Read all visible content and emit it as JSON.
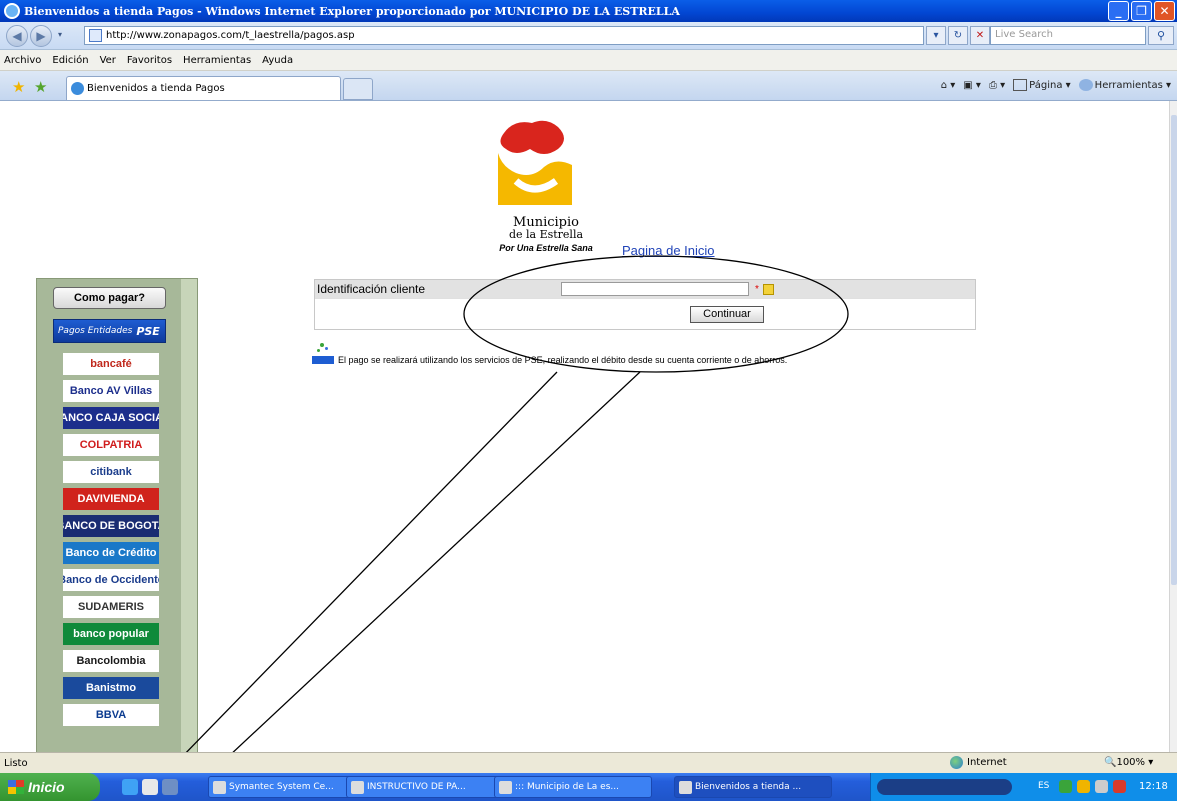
{
  "window": {
    "title": "Bienvenidos a tienda Pagos - Windows Internet Explorer proporcionado por MUNICIPIO DE LA ESTRELLA"
  },
  "address_bar": {
    "url": "http://www.zonapagos.com/t_laestrella/pagos.asp",
    "search_placeholder": "Live Search"
  },
  "menu": [
    "Archivo",
    "Edición",
    "Ver",
    "Favoritos",
    "Herramientas",
    "Ayuda"
  ],
  "tab": {
    "label": "Bienvenidos a tienda Pagos"
  },
  "command_bar": {
    "page": "Página",
    "tools": "Herramientas"
  },
  "page": {
    "logo": {
      "name_line1": "Municipio",
      "name_line2": "de la Estrella",
      "tagline": "Por Una Estrella Sana"
    },
    "home_link": "Pagina de Inicio",
    "sidebar": {
      "como_pagar": "Como pagar?",
      "pse_label": "Pagos Entidades",
      "pse_logo": "PSE",
      "banks": [
        {
          "name": "bancafé",
          "bg": "#ffffff",
          "color": "#c0281c"
        },
        {
          "name": "Banco AV Villas",
          "bg": "#ffffff",
          "color": "#1c2e8c"
        },
        {
          "name": "BANCO CAJA SOCIAL",
          "bg": "#1c2e8c",
          "color": "#ffffff"
        },
        {
          "name": "COLPATRIA",
          "bg": "#ffffff",
          "color": "#d01c1c"
        },
        {
          "name": "citibank",
          "bg": "#ffffff",
          "color": "#1c3e8c"
        },
        {
          "name": "DAVIVIENDA",
          "bg": "#d0231c",
          "color": "#ffffff"
        },
        {
          "name": "BANCO DE BOGOTA",
          "bg": "#1a2c72",
          "color": "#ffffff"
        },
        {
          "name": "Banco de Crédito",
          "bg": "#1a78c8",
          "color": "#ffffff"
        },
        {
          "name": "Banco de Occidente",
          "bg": "#ffffff",
          "color": "#1a3c8c"
        },
        {
          "name": "SUDAMERIS",
          "bg": "#ffffff",
          "color": "#333333"
        },
        {
          "name": "banco popular",
          "bg": "#0f8a3a",
          "color": "#ffffff"
        },
        {
          "name": "Bancolombia",
          "bg": "#ffffff",
          "color": "#1a1a1a"
        },
        {
          "name": "Banistmo",
          "bg": "#1a4a9c",
          "color": "#ffffff"
        },
        {
          "name": "BBVA",
          "bg": "#ffffff",
          "color": "#0b3b8f"
        }
      ]
    },
    "form": {
      "label": "Identificación cliente",
      "value": "",
      "required_mark": "*",
      "submit": "Continuar"
    },
    "note": "El pago se realizará utilizando los servicios de PSE, realizando el débito desde su cuenta corriente o de ahorros."
  },
  "status_bar": {
    "status": "Listo",
    "zone": "Internet",
    "zoom": "100%"
  },
  "taskbar": {
    "start": "Inicio",
    "tasks": [
      {
        "label": "Symantec System Ce...",
        "active": false
      },
      {
        "label": "INSTRUCTIVO DE PA...",
        "active": false
      },
      {
        "label": "::: Municipio de La es...",
        "active": false
      },
      {
        "label": "Bienvenidos a tienda ...",
        "active": true
      }
    ],
    "language": "ES",
    "clock": "12:18"
  }
}
